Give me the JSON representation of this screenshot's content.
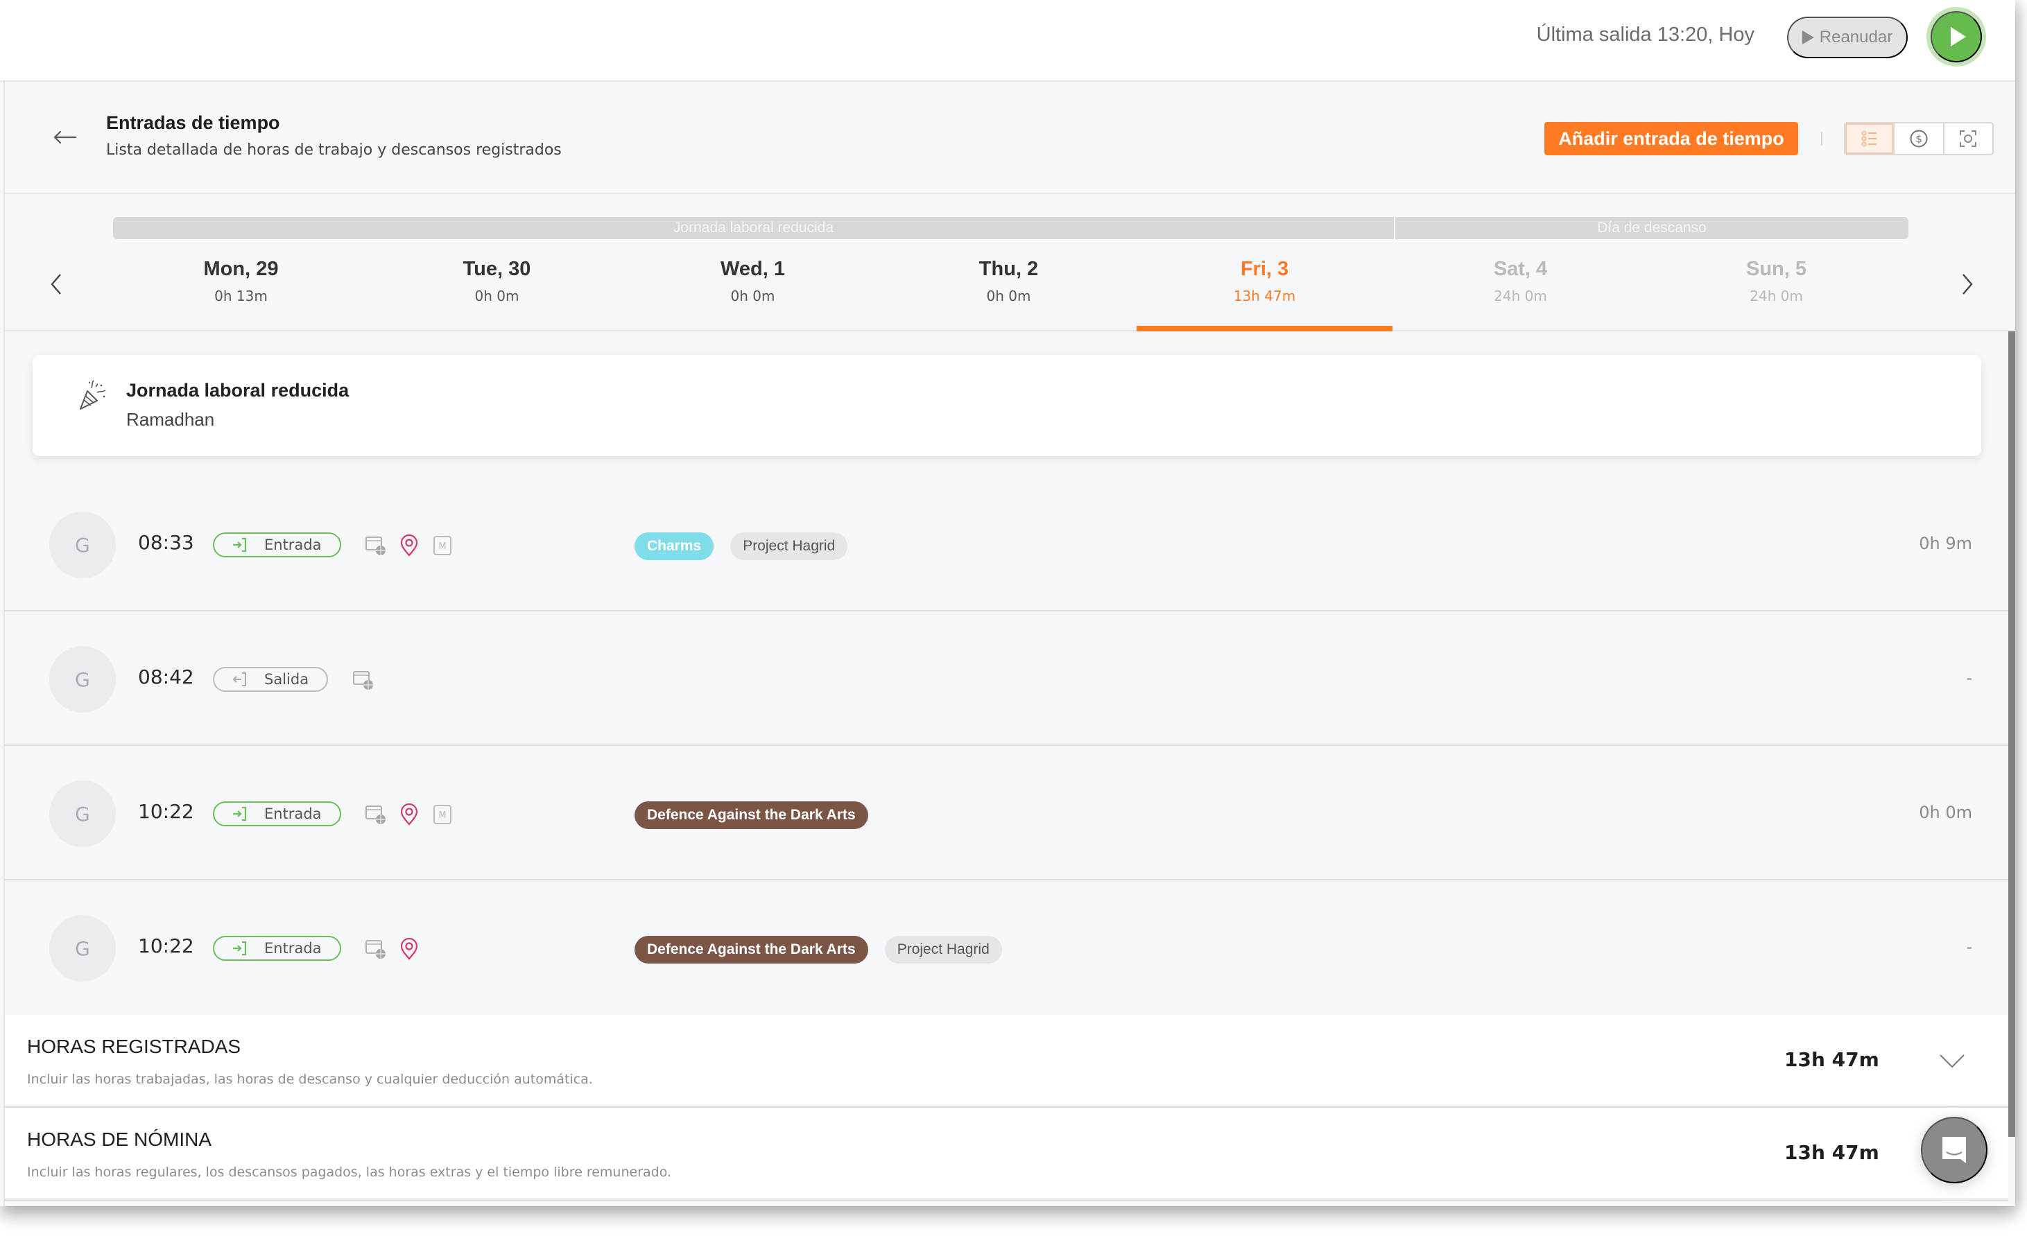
{
  "topbar": {
    "last_out": "Última salida 13:20, Hoy",
    "resume_label": "Reanudar",
    "play_color": "#66bb4e"
  },
  "header": {
    "title": "Entradas de tiempo",
    "subtitle": "Lista detallada de horas de trabajo y descansos registrados",
    "add_button": "Añadir entrada de tiempo",
    "accent_color": "#ff7a22",
    "view_toggle": [
      "list-icon",
      "dollar-icon",
      "scan-icon"
    ],
    "active_view": 0
  },
  "datestrip": {
    "banners": [
      {
        "label": "Jornada laboral reducida",
        "spans_days": 5
      },
      {
        "label": "Día de descanso",
        "spans_days": 2
      }
    ],
    "days": [
      {
        "name": "Mon, 29",
        "hours": "0h 13m",
        "state": "normal"
      },
      {
        "name": "Tue, 30",
        "hours": "0h 0m",
        "state": "normal"
      },
      {
        "name": "Wed, 1",
        "hours": "0h 0m",
        "state": "normal"
      },
      {
        "name": "Thu, 2",
        "hours": "0h 0m",
        "state": "normal"
      },
      {
        "name": "Fri, 3",
        "hours": "13h 47m",
        "state": "selected"
      },
      {
        "name": "Sat, 4",
        "hours": "24h 0m",
        "state": "off"
      },
      {
        "name": "Sun, 5",
        "hours": "24h 0m",
        "state": "off"
      }
    ]
  },
  "holiday": {
    "title": "Jornada laboral reducida",
    "subtitle": "Ramadhan"
  },
  "entries": [
    {
      "avatar": "G",
      "time": "08:33",
      "type": "Entrada",
      "direction": "in",
      "icons": [
        "web-device-icon",
        "location-pin-icon",
        "manual-m-icon"
      ],
      "tags": [
        {
          "label": "Charms",
          "bg": "#7fdde9",
          "fg": "#ffffff"
        },
        {
          "label": "Project Hagrid",
          "bg": "#e6e6e6",
          "fg": "#555555"
        }
      ],
      "duration": "0h 9m"
    },
    {
      "avatar": "G",
      "time": "08:42",
      "type": "Salida",
      "direction": "out",
      "icons": [
        "web-device-icon"
      ],
      "tags": [],
      "duration": "-"
    },
    {
      "avatar": "G",
      "time": "10:22",
      "type": "Entrada",
      "direction": "in",
      "icons": [
        "web-device-icon",
        "location-pin-icon",
        "manual-m-icon"
      ],
      "tags": [
        {
          "label": "Defence Against the Dark Arts",
          "bg": "#7b5546",
          "fg": "#ffffff"
        }
      ],
      "duration": "0h 0m"
    },
    {
      "avatar": "G",
      "time": "10:22",
      "type": "Entrada",
      "direction": "in",
      "icons": [
        "web-device-icon",
        "location-pin-icon"
      ],
      "tags": [
        {
          "label": "Defence Against the Dark Arts",
          "bg": "#7b5546",
          "fg": "#ffffff"
        },
        {
          "label": "Project Hagrid",
          "bg": "#e6e6e6",
          "fg": "#555555"
        }
      ],
      "duration": "-"
    }
  ],
  "summary": [
    {
      "title": "HORAS REGISTRADAS",
      "description": "Incluir las horas trabajadas, las horas de descanso y cualquier deducción automática.",
      "value": "13h 47m",
      "expandable": true
    },
    {
      "title": "HORAS DE NÓMINA",
      "description": "Incluir las horas regulares, los descansos pagados, las horas extras y el tiempo libre remunerado.",
      "value": "13h 47m",
      "expandable": false
    }
  ]
}
